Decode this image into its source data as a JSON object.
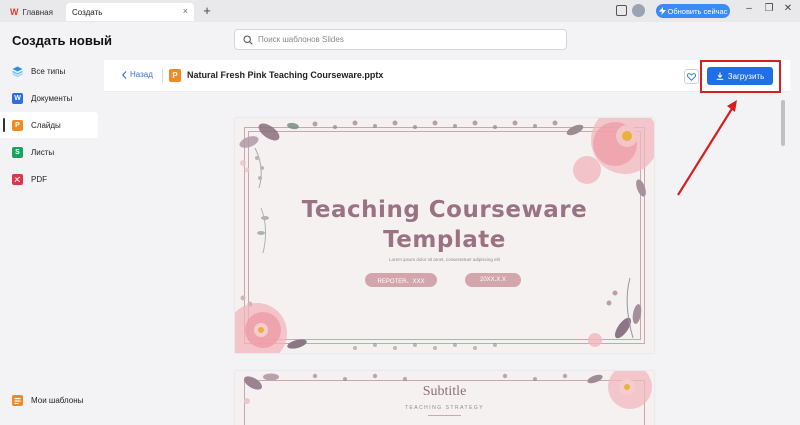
{
  "titlebar": {
    "tabs": [
      {
        "label": "Главная"
      },
      {
        "label": "Создать"
      }
    ],
    "new_tab_symbol": "+",
    "tab_close_symbol": "×",
    "update_button": "Обновить сейчас"
  },
  "sidebar": {
    "title": "Создать новый",
    "items": [
      {
        "label": "Все типы",
        "icon": "all-types-icon",
        "color": "#2d8cf0"
      },
      {
        "label": "Документы",
        "icon": "W",
        "color": "#2f6ee0"
      },
      {
        "label": "Слайды",
        "icon": "P",
        "color": "#f08a24",
        "active": true
      },
      {
        "label": "Листы",
        "icon": "S",
        "color": "#1aa35a"
      },
      {
        "label": "PDF",
        "icon": "pdf-icon",
        "color": "#e0344b"
      }
    ],
    "my_templates": "Мои шаблоны"
  },
  "search": {
    "placeholder": "Поиск шаблонов Slides"
  },
  "header": {
    "back_label": "Назад",
    "file_name": "Natural Fresh Pink Teaching Courseware.pptx",
    "download_label": "Загрузить"
  },
  "slides": [
    {
      "title_line1": "Teaching Courseware",
      "title_line2": "Template",
      "lorem": "Lorem ipsum dolor sit amet, consectetuer adipiscing elit",
      "reporter": "REPOTER、XXX",
      "date": "20XX.X.X"
    },
    {
      "title": "Subtitle",
      "caption": "TEACHING STRATEGY"
    }
  ],
  "colors": {
    "accent": "#1f6fe5",
    "highlight": "#d42020",
    "slide_title": "#9a7283",
    "pill": "#d2a6ab"
  }
}
